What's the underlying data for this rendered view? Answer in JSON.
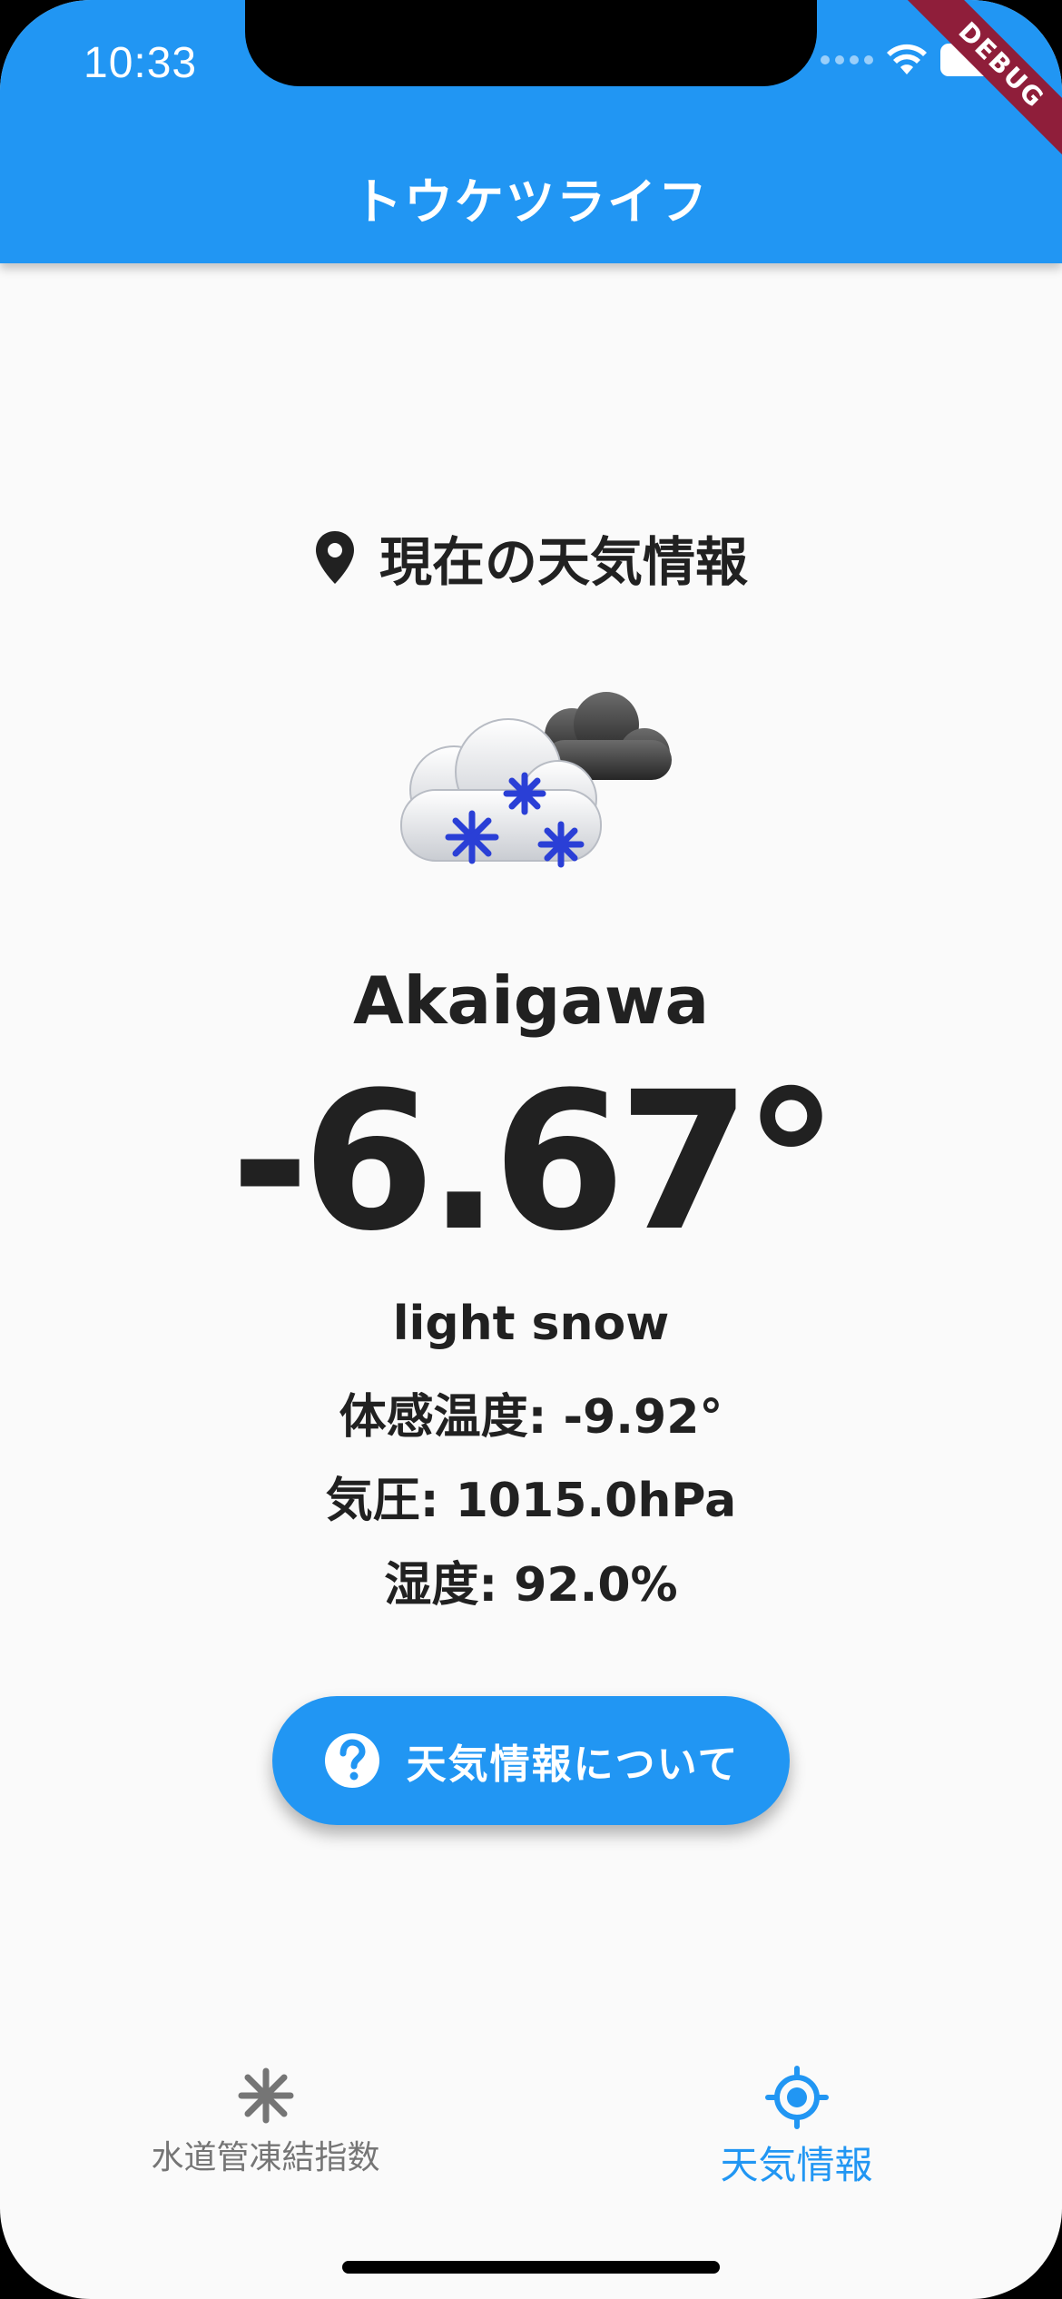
{
  "status_bar": {
    "time": "10:33"
  },
  "app_bar": {
    "title": "トウケツライフ",
    "debug_label": "DEBUG"
  },
  "heading": {
    "text": "現在の天気情報",
    "icon": "location-pin-icon"
  },
  "weather": {
    "icon": "light-snow-cloud-icon",
    "city": "Akaigawa",
    "temperature": "-6.67°",
    "description": "light snow",
    "feels_like": "体感温度: -9.92°",
    "pressure": "気圧: 1015.0hPa",
    "humidity": "湿度: 92.0%"
  },
  "about_button": {
    "label": "天気情報について",
    "icon": "help-circle-icon"
  },
  "bottom_nav": [
    {
      "label": "水道管凍結指数",
      "icon": "snowflake-icon",
      "active": false
    },
    {
      "label": "天気情報",
      "icon": "gps-target-icon",
      "active": true
    }
  ],
  "colors": {
    "primary": "#2196f3",
    "text": "#212121",
    "inactive": "#757575",
    "background": "#fafafa"
  }
}
